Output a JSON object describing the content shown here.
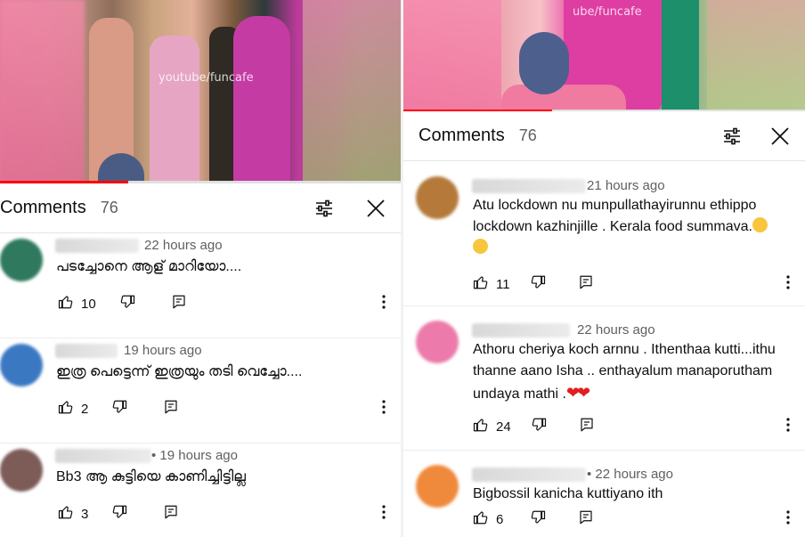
{
  "left": {
    "watermark": "youtube/funcafe",
    "progress": 0.32,
    "header": {
      "title": "Comments",
      "count": "76"
    },
    "comments": [
      {
        "time": "22 hours ago",
        "text": "പടച്ചോനെ ആള് മാറിയോ....",
        "likes": "10",
        "avatar_color": "#2f7a5e"
      },
      {
        "time": "19 hours ago",
        "text": "ഇത്ര പെട്ടെന്ന് ഇത്രയും തടി  വെച്ചോ....",
        "likes": "2",
        "avatar_color": "#3b78c2"
      },
      {
        "time": "• 19 hours ago",
        "text": "Bb3 ആ കുട്ടിയെ കാണിച്ചിട്ടില്ല",
        "likes": "3",
        "avatar_color": "#7d5c58"
      }
    ]
  },
  "right": {
    "watermark": "ube/funcafe",
    "progress": 0.37,
    "header": {
      "title": "Comments",
      "count": "76"
    },
    "comments": [
      {
        "time": "21 hours ago",
        "text": "Atu lockdown nu munpullathayirunnu ethippo lockdown kazhinjille . Kerala food summava.",
        "likes": "11",
        "avatar_color": "#b57a3a"
      },
      {
        "time": "22 hours ago",
        "text": "Athoru cheriya koch arnnu . Ithenthaa kutti...ithu thanne aano Isha .. enthayalum manaporutham undaya mathi .",
        "likes": "24",
        "avatar_color": "#ec7bab"
      },
      {
        "time": "• 22 hours ago",
        "text": "Bigbossil kanicha kuttiyano ith",
        "likes": "6",
        "avatar_color": "#ef8a3c"
      }
    ]
  },
  "icons": {
    "like": "thumb-up-icon",
    "dislike": "thumb-down-icon",
    "reply": "reply-icon",
    "more": "more-vertical-icon",
    "filter": "filter-icon",
    "close": "close-icon"
  }
}
